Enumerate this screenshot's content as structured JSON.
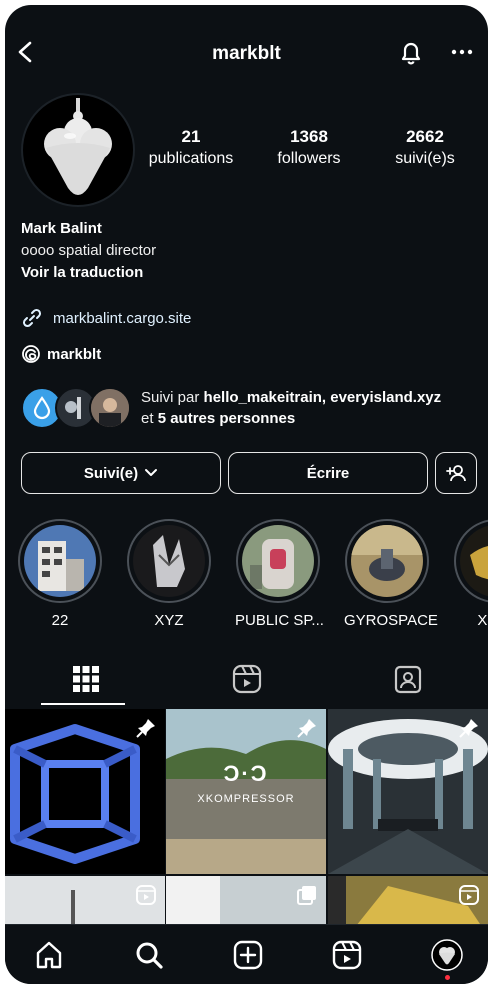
{
  "header": {
    "username": "markblt"
  },
  "stats": [
    {
      "value": "21",
      "label": "publications"
    },
    {
      "value": "1368",
      "label": "followers"
    },
    {
      "value": "2662",
      "label": "suivi(e)s"
    }
  ],
  "profile": {
    "name": "Mark Balint",
    "bio": "oooo spatial director",
    "translate": "Voir la traduction",
    "link": "markbalint.cargo.site",
    "threads": "markblt"
  },
  "mutual": {
    "prefix": "Suivi par ",
    "names": "hello_makeitrain, everyisland.xyz",
    "mid": "et ",
    "others": "5 autres personnes"
  },
  "buttons": {
    "following": "Suivi(e)",
    "message": "Écrire"
  },
  "highlights": [
    {
      "label": "22"
    },
    {
      "label": "XYZ"
    },
    {
      "label": "PUBLIC SP..."
    },
    {
      "label": "GYROSPACE"
    },
    {
      "label": "XLAY"
    }
  ],
  "posts": {
    "kompressor_logo": "Ɔ·Ɔ",
    "kompressor_title": "XKOMPRESSOR"
  },
  "colors": {
    "background": "#0c1014",
    "link": "#e0f1ff",
    "notification_dot": "#ff3040"
  }
}
